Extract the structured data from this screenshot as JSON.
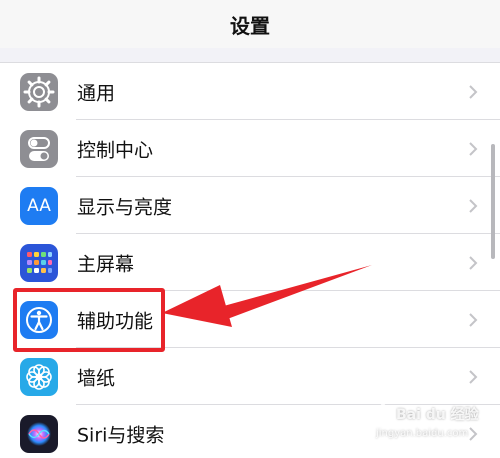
{
  "navbar": {
    "title": "设置"
  },
  "settings_items": [
    {
      "label": "通用",
      "icon": "gear-icon",
      "icon_color": "#8e8e93"
    },
    {
      "label": "控制中心",
      "icon": "toggles-icon",
      "icon_color": "#8e8e93"
    },
    {
      "label": "显示与亮度",
      "icon": "text-size-icon",
      "icon_color": "#1e7cf2",
      "icon_text": "AA"
    },
    {
      "label": "主屏幕",
      "icon": "home-screen-grid-icon",
      "icon_color": "#2b55d8"
    },
    {
      "label": "辅助功能",
      "icon": "accessibility-icon",
      "icon_color": "#1e7cf2",
      "highlighted": true
    },
    {
      "label": "墙纸",
      "icon": "flower-icon",
      "icon_color": "#27a9e8"
    },
    {
      "label": "Siri与搜索",
      "icon": "siri-icon",
      "icon_color": "#1a1a2a"
    }
  ],
  "annotation": {
    "highlight_color": "#e8242a",
    "target": "辅助功能"
  },
  "watermark": {
    "line1": "Bai du 经验",
    "line2": "jingyan.baidu.com"
  }
}
